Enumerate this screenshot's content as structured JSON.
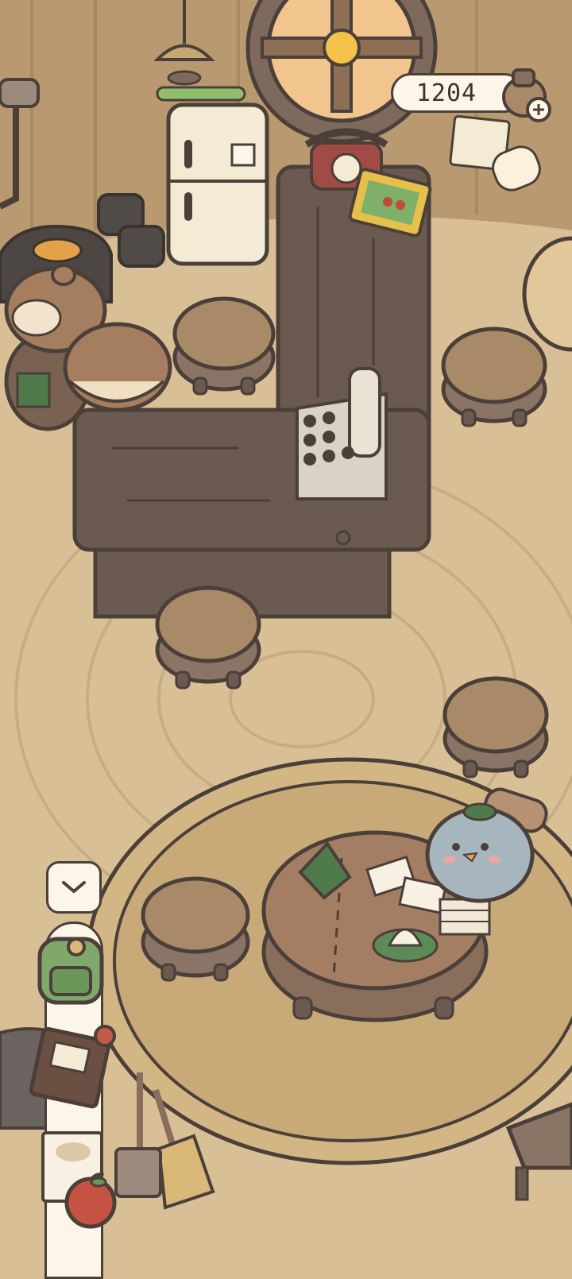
{
  "hud": {
    "coin_count": "1204",
    "coin_icon": "coin-bag-icon",
    "add_icon": "plus-icon"
  },
  "inventory": {
    "toggle_icon": "chevron-down-icon",
    "items": [
      {
        "name": "green-backpack",
        "icon": "backpack-icon"
      },
      {
        "name": "brown-book",
        "icon": "book-icon"
      },
      {
        "name": "paper-notes",
        "icon": "paper-icon"
      },
      {
        "name": "red-apple",
        "icon": "apple-icon"
      }
    ]
  },
  "colors": {
    "floor": "#d8bf95",
    "rug": "#c7aa78",
    "wood_dark": "#6b5a50",
    "wood_light": "#a88968",
    "outline": "#4b3f3a",
    "panel": "#fbf6e8"
  }
}
